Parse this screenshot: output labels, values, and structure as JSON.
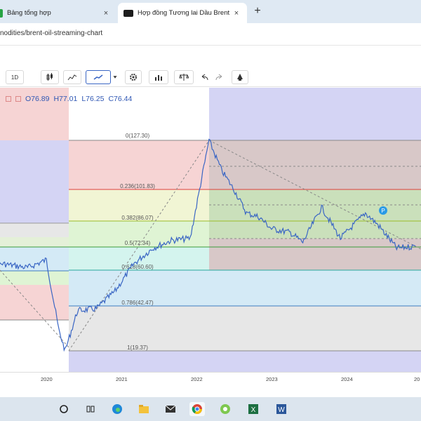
{
  "browser": {
    "tabs": [
      {
        "label": "Bảng tổng hợp",
        "active": false
      },
      {
        "label": "Hợp đồng Tương lai Dầu Brent",
        "active": true
      }
    ],
    "new_tab_symbol": "+",
    "close_symbol": "×",
    "url_fragment": "nodities/brent-oil-streaming-chart"
  },
  "toolbar": {
    "interval_label": "1D",
    "icons": [
      "candles-icon",
      "bars-icon",
      "line-icon",
      "dropdown-icon",
      "gear-icon",
      "indicator-icon",
      "compare-icon",
      "undo-icon",
      "redo-icon",
      "drawing-icon"
    ]
  },
  "ohlc": {
    "open_key": "O",
    "open": "76.89",
    "high_key": "H",
    "high": "77.01",
    "low_key": "L",
    "low": "76.25",
    "close_key": "C",
    "close": "76.44"
  },
  "fibonacci": [
    {
      "label": "0(127.30)",
      "color": "#888888"
    },
    {
      "label": "0.236(101.83)",
      "color": "#e03c3c"
    },
    {
      "label": "0.382(86.07)",
      "color": "#9abc2a"
    },
    {
      "label": "0.5(72.34)",
      "color": "#3c9c3c"
    },
    {
      "label": "0.618(60.60)",
      "color": "#29a89c"
    },
    {
      "label": "0.786(42.47)",
      "color": "#3c7cc0"
    },
    {
      "label": "1(19.37)",
      "color": "#888888"
    }
  ],
  "xaxis": {
    "labels": [
      "2020",
      "2021",
      "2022",
      "2023",
      "2024",
      "20"
    ]
  },
  "chart_data": {
    "type": "line",
    "x": [
      "2019-01",
      "2019-06",
      "2019-10",
      "2020-01",
      "2020-03",
      "2020-04",
      "2020-06",
      "2020-09",
      "2020-12",
      "2021-03",
      "2021-06",
      "2021-09",
      "2021-12",
      "2022-03",
      "2022-05",
      "2022-07",
      "2022-09",
      "2022-11",
      "2023-01",
      "2023-04",
      "2023-06",
      "2023-09",
      "2023-12",
      "2024-04",
      "2024-06",
      "2024-09",
      "2024-12"
    ],
    "y": [
      63,
      64,
      62,
      66,
      30,
      19.4,
      40,
      41,
      50,
      64,
      72,
      76,
      77,
      127.3,
      112,
      102,
      90,
      88,
      82,
      80,
      75,
      93,
      77,
      90,
      84,
      72,
      73
    ],
    "series_color": "#3a66c4",
    "grid": true
  },
  "taskbar": {
    "icons": [
      "start-circle-icon",
      "task-view-icon",
      "edge-icon",
      "folder-icon",
      "mail-icon",
      "chrome-icon",
      "coccoc-icon",
      "excel-icon",
      "word-icon"
    ]
  }
}
